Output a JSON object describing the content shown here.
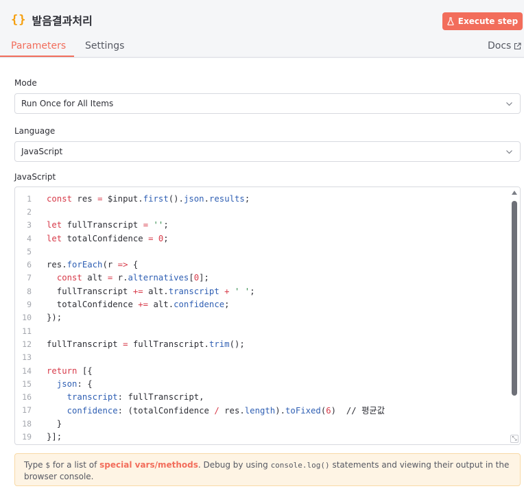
{
  "header": {
    "node_icon": "{}",
    "node_title": "발음결과처리",
    "execute_label": "Execute step",
    "tabs": [
      "Parameters",
      "Settings"
    ],
    "docs_label": "Docs"
  },
  "fields": {
    "mode_label": "Mode",
    "mode_value": "Run Once for All Items",
    "language_label": "Language",
    "language_value": "JavaScript",
    "code_label": "JavaScript"
  },
  "code_lines": [
    "const res = $input.first().json.results;",
    "",
    "let fullTranscript = '';",
    "let totalConfidence = 0;",
    "",
    "res.forEach(r => {",
    "  const alt = r.alternatives[0];",
    "  fullTranscript += alt.transcript + ' ';",
    "  totalConfidence += alt.confidence;",
    "});",
    "",
    "fullTranscript = fullTranscript.trim();",
    "",
    "return [{",
    "  json: {",
    "    transcript: fullTranscript,",
    "    confidence: (totalConfidence / res.length).toFixed(6)  // 평균값",
    "  }",
    "}];"
  ],
  "hint": {
    "part1": "Type ",
    "dollar": "$",
    "part2": " for a list of ",
    "link": "special vars/methods",
    "part3": ". Debug by using ",
    "console_log": "console.log()",
    "part4": " statements and viewing their output in the browser console."
  },
  "colors": {
    "accent": "#f26d5b",
    "braces": "#f59e0b",
    "hint_bg": "#fef4e4"
  },
  "icons": {
    "node": "code-braces-icon",
    "execute": "flask-icon",
    "docs": "external-link-icon",
    "select": "chevron-down-icon"
  }
}
